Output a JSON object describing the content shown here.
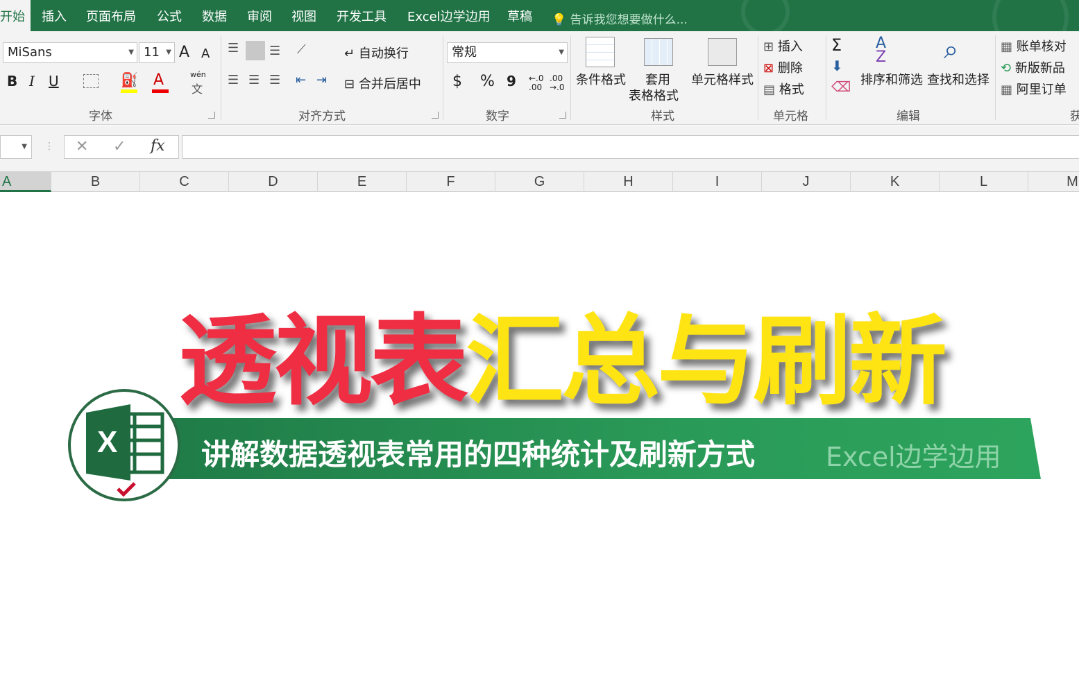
{
  "tabs": [
    {
      "label": "开始",
      "active": true
    },
    {
      "label": "插入"
    },
    {
      "label": "页面布局"
    },
    {
      "label": "公式"
    },
    {
      "label": "数据"
    },
    {
      "label": "审阅"
    },
    {
      "label": "视图"
    },
    {
      "label": "开发工具"
    },
    {
      "label": "Excel边学边用"
    },
    {
      "label": "草稿"
    }
  ],
  "tell_me": "告诉我您想要做什么...",
  "font_group": {
    "font_name": "MiSans",
    "font_size": "11",
    "label": "字体",
    "bold": "B",
    "italic": "I",
    "underline": "U",
    "grow": "A",
    "shrink": "A",
    "font_color_glyph": "A",
    "phonetic_top": "wén",
    "phonetic_bottom": "文"
  },
  "align_group": {
    "wrap": "自动换行",
    "merge": "合并后居中",
    "label": "对齐方式"
  },
  "number_group": {
    "format": "常规",
    "currency": "$",
    "percent": "%",
    "comma": "9",
    "label": "数字"
  },
  "styles_group": {
    "conditional": "条件格式",
    "table_1": "套用",
    "table_2": "表格格式",
    "cell_styles": "单元格样式",
    "label": "样式"
  },
  "cells_group": {
    "insert": "插入",
    "delete": "删除",
    "format": "格式",
    "label": "单元格"
  },
  "editing_group": {
    "sort_filter": "排序和筛选",
    "find_select": "查找和选择",
    "label": "编辑"
  },
  "addins": {
    "item1": "账单核对",
    "item2": "新版新品",
    "item3": "阿里订单",
    "label_partial": "获"
  },
  "formula_bar": {
    "fx": "fx",
    "cancel": "✕",
    "confirm": "✓"
  },
  "columns": [
    "A",
    "B",
    "C",
    "D",
    "E",
    "F",
    "G",
    "H",
    "I",
    "J",
    "K",
    "L",
    "M"
  ],
  "headline": {
    "red_part": "透视表",
    "yellow_part": "汇总与刷新"
  },
  "banner": {
    "subtitle": "讲解数据透视表常用的四种统计及刷新方式",
    "brand": "Excel边学边用"
  },
  "logo": {
    "letter": "X"
  },
  "colors": {
    "excel_green": "#217346",
    "headline_red": "#ef2d43",
    "headline_yellow": "#ffe414"
  }
}
